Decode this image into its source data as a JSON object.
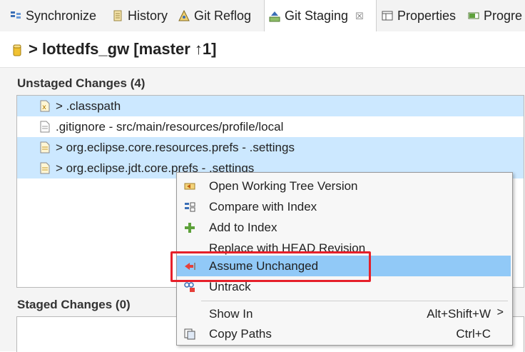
{
  "tabs": [
    {
      "label": "Synchronize",
      "icon": "synchronize-icon"
    },
    {
      "label": "History",
      "icon": "history-icon"
    },
    {
      "label": "Git Reflog",
      "icon": "git-reflog-icon"
    },
    {
      "label": "Git Staging",
      "icon": "git-staging-icon",
      "active": true,
      "close": "☒"
    },
    {
      "label": "Properties",
      "icon": "properties-icon"
    },
    {
      "label": "Progre",
      "icon": "progress-icon"
    }
  ],
  "header": {
    "title": "> lottedfs_gw [master ↑1]"
  },
  "unstaged": {
    "label": "Unstaged Changes (4)",
    "items": [
      {
        "text": "> .classpath",
        "selected": true
      },
      {
        "text": ".gitignore - src/main/resources/profile/local",
        "selected": false
      },
      {
        "text": "> org.eclipse.core.resources.prefs - .settings",
        "selected": true
      },
      {
        "text": "> org.eclipse.jdt.core.prefs - .settings",
        "selected": true
      }
    ]
  },
  "staged": {
    "label": "Staged Changes (0)"
  },
  "context_menu": {
    "items": [
      {
        "label": "Open Working Tree Version",
        "icon": "open-working-tree-icon"
      },
      {
        "label": "Compare with Index",
        "icon": "compare-icon"
      },
      {
        "label": "Add to Index",
        "icon": "add-icon"
      },
      {
        "label": "Replace with HEAD Revision",
        "icon": ""
      },
      {
        "label": "Assume Unchanged",
        "icon": "assume-unchanged-icon",
        "highlighted": true
      },
      {
        "label": "Untrack",
        "icon": "untrack-icon"
      },
      {
        "label": "Show In",
        "accelerator": "Alt+Shift+W",
        "submenu": ">"
      },
      {
        "label": "Copy Paths",
        "icon": "copy-paths-icon",
        "accelerator": "Ctrl+C"
      }
    ]
  },
  "colors": {
    "selection": "#cce8ff",
    "menu_highlight": "#91c9f7",
    "annotation_box": "#e6202a"
  }
}
